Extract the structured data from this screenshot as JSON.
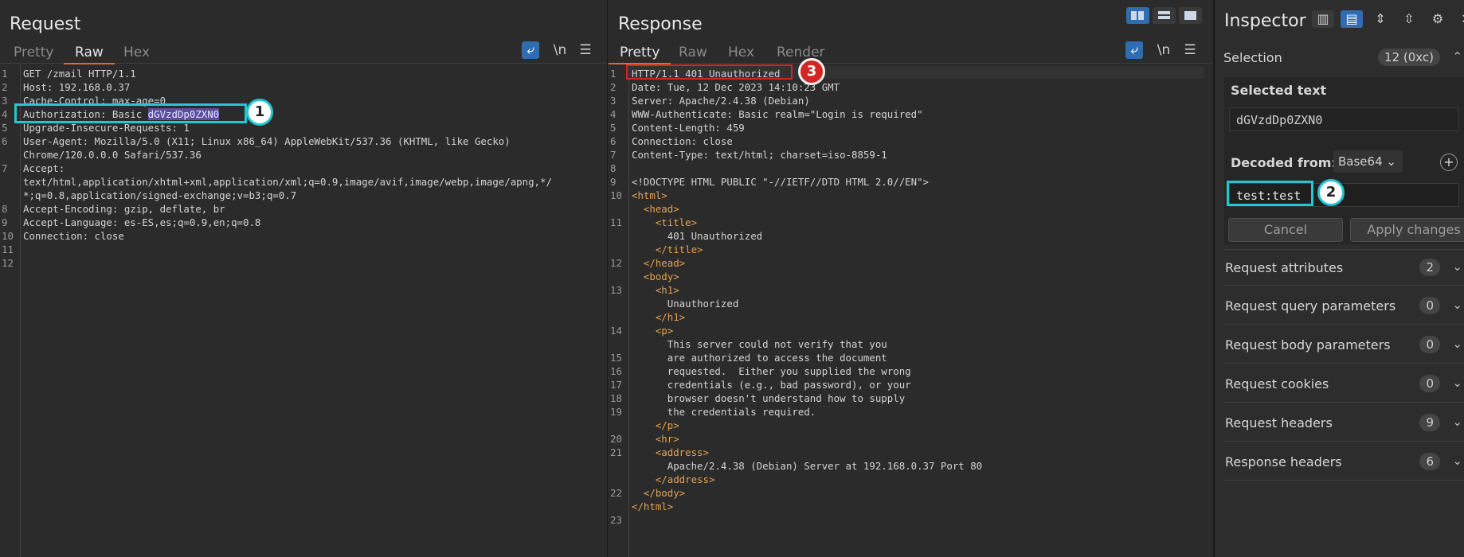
{
  "request": {
    "title": "Request",
    "tabs": [
      "Pretty",
      "Raw",
      "Hex"
    ],
    "active_tab": "Raw",
    "newline_label": "\\n",
    "lines": [
      {
        "n": "1",
        "text": "GET /zmail HTTP/1.1"
      },
      {
        "n": "2",
        "text": "Host: 192.168.0.37"
      },
      {
        "n": "3",
        "text": "Cache-Control: max-age=0"
      },
      {
        "n": "4",
        "prefix": "Authorization: Basic ",
        "sel": "dGVzdDp0ZXN0"
      },
      {
        "n": "5",
        "text": "Upgrade-Insecure-Requests: 1"
      },
      {
        "n": "6",
        "text": "User-Agent: Mozilla/5.0 (X11; Linux x86_64) AppleWebKit/537.36 (KHTML, like Gecko)"
      },
      {
        "n": "",
        "text": "Chrome/120.0.0.0 Safari/537.36"
      },
      {
        "n": "7",
        "text": "Accept:"
      },
      {
        "n": "",
        "text": "text/html,application/xhtml+xml,application/xml;q=0.9,image/avif,image/webp,image/apng,*/"
      },
      {
        "n": "",
        "text": "*;q=0.8,application/signed-exchange;v=b3;q=0.7"
      },
      {
        "n": "8",
        "text": "Accept-Encoding: gzip, deflate, br"
      },
      {
        "n": "9",
        "text": "Accept-Language: es-ES,es;q=0.9,en;q=0.8"
      },
      {
        "n": "10",
        "text": "Connection: close"
      },
      {
        "n": "11",
        "text": ""
      },
      {
        "n": "12",
        "text": ""
      }
    ]
  },
  "response": {
    "title": "Response",
    "tabs": [
      "Pretty",
      "Raw",
      "Hex",
      "Render"
    ],
    "active_tab": "Pretty",
    "newline_label": "\\n",
    "lines": [
      {
        "n": "1",
        "text": "HTTP/1.1 401 Unauthorized"
      },
      {
        "n": "2",
        "text": "Date: Tue, 12 Dec 2023 14:10:23 GMT"
      },
      {
        "n": "3",
        "text": "Server: Apache/2.4.38 (Debian)"
      },
      {
        "n": "4",
        "text": "WWW-Authenticate: Basic realm=\"Login is required\""
      },
      {
        "n": "5",
        "text": "Content-Length: 459"
      },
      {
        "n": "6",
        "text": "Connection: close"
      },
      {
        "n": "7",
        "text": "Content-Type: text/html; charset=iso-8859-1"
      },
      {
        "n": "8",
        "text": ""
      },
      {
        "n": "9",
        "text": "<!DOCTYPE HTML PUBLIC \"-//IETF//DTD HTML 2.0//EN\">"
      },
      {
        "n": "10",
        "tag": "<html>",
        "indent": ""
      },
      {
        "n": "",
        "tag": "<head>",
        "indent": "  "
      },
      {
        "n": "11",
        "tag": "<title>",
        "indent": "    "
      },
      {
        "n": "",
        "text": "      401 Unauthorized"
      },
      {
        "n": "",
        "tag": "</title>",
        "indent": "    "
      },
      {
        "n": "12",
        "tag": "</head>",
        "indent": "  "
      },
      {
        "n": "",
        "tag": "<body>",
        "indent": "  "
      },
      {
        "n": "13",
        "tag": "<h1>",
        "indent": "    "
      },
      {
        "n": "",
        "text": "      Unauthorized"
      },
      {
        "n": "",
        "tag": "</h1>",
        "indent": "    "
      },
      {
        "n": "14",
        "tag": "<p>",
        "indent": "    "
      },
      {
        "n": "",
        "text": "      This server could not verify that you"
      },
      {
        "n": "15",
        "text": "      are authorized to access the document"
      },
      {
        "n": "16",
        "text": "      requested.  Either you supplied the wrong"
      },
      {
        "n": "17",
        "text": "      credentials (e.g., bad password), or your"
      },
      {
        "n": "18",
        "text": "      browser doesn't understand how to supply"
      },
      {
        "n": "19",
        "text": "      the credentials required."
      },
      {
        "n": "",
        "tag": "</p>",
        "indent": "    "
      },
      {
        "n": "20",
        "tag": "<hr>",
        "indent": "    "
      },
      {
        "n": "21",
        "tag": "<address>",
        "indent": "    "
      },
      {
        "n": "",
        "text": "      Apache/2.4.38 (Debian) Server at 192.168.0.37 Port 80"
      },
      {
        "n": "",
        "tag": "</address>",
        "indent": "    "
      },
      {
        "n": "22",
        "tag": "</body>",
        "indent": "  "
      },
      {
        "n": "",
        "tag": "</html>",
        "indent": ""
      },
      {
        "n": "23",
        "text": ""
      }
    ]
  },
  "inspector": {
    "title": "Inspector",
    "selection_label": "Selection",
    "selection_count": "12 (0xc)",
    "selected_text_label": "Selected text",
    "selected_text": "dGVzdDp0ZXN0",
    "decoded_from_label": "Decoded from:",
    "decoded_from_value": "Base64",
    "decoded_value": "test:test",
    "cancel_label": "Cancel",
    "apply_label": "Apply changes",
    "sections": [
      {
        "label": "Request attributes",
        "count": "2"
      },
      {
        "label": "Request query parameters",
        "count": "0"
      },
      {
        "label": "Request body parameters",
        "count": "0"
      },
      {
        "label": "Request cookies",
        "count": "0"
      },
      {
        "label": "Request headers",
        "count": "9"
      },
      {
        "label": "Response headers",
        "count": "6"
      }
    ]
  },
  "annotations": {
    "one": "1",
    "two": "2",
    "three": "3"
  },
  "colors": {
    "accent_cyan": "#22c7d3",
    "accent_red": "#d42525",
    "accent_blue": "#2f6db3",
    "tab_underline": "#e06a2c"
  }
}
